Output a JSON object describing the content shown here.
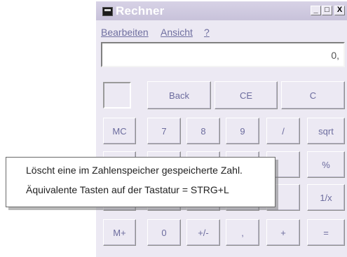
{
  "window": {
    "title": "Rechner"
  },
  "titlebar_buttons": {
    "minimize": "_",
    "maximize": "□",
    "close": "X"
  },
  "menu": {
    "items": [
      {
        "label": "Bearbeiten"
      },
      {
        "label": "Ansicht"
      },
      {
        "label": "?"
      }
    ]
  },
  "display": {
    "value": "0,"
  },
  "buttons": {
    "back": "Back",
    "ce": "CE",
    "c": "C",
    "mc": "MC",
    "seven": "7",
    "eight": "8",
    "nine": "9",
    "divide": "/",
    "sqrt": "sqrt",
    "percent": "%",
    "reciprocal": "1/x",
    "mplus": "M+",
    "zero": "0",
    "plusminus": "+/-",
    "comma": ",",
    "plus": "+",
    "equals": "="
  },
  "tooltip": {
    "line1": "Löscht eine im Zahlenspeicher gespeicherte Zahl.",
    "line2": "Äquivalente Tasten auf der Tastatur = STRG+L"
  }
}
